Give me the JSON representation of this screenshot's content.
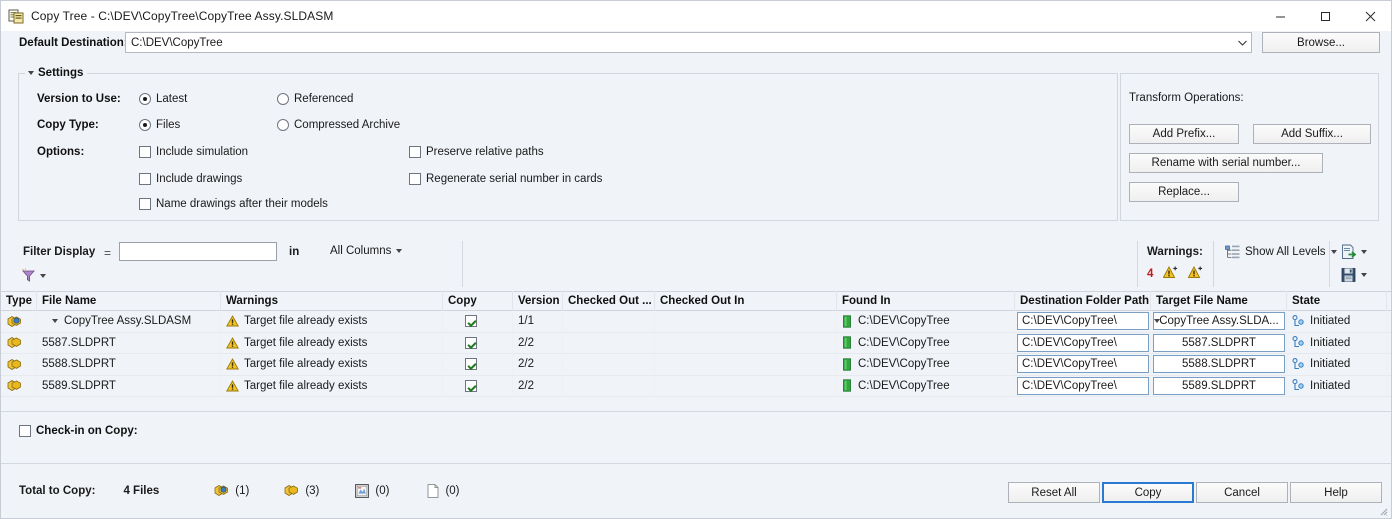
{
  "window": {
    "title": "Copy Tree - C:\\DEV\\CopyTree\\CopyTree Assy.SLDASM",
    "app_icon": "copy-tree-icon",
    "minimize_label": "─",
    "maximize_label": "□",
    "close_label": "✕"
  },
  "destination": {
    "label": "Default Destination:",
    "value": "C:\\DEV\\CopyTree",
    "placeholder": "",
    "browse_label": "Browse..."
  },
  "settings": {
    "group_label": "Settings",
    "version_label": "Version to Use:",
    "version_options": [
      {
        "label": "Latest",
        "selected": true
      },
      {
        "label": "Referenced",
        "selected": false
      }
    ],
    "copy_type_label": "Copy Type:",
    "copy_type_options": [
      {
        "label": "Files",
        "selected": true
      },
      {
        "label": "Compressed Archive",
        "selected": false
      }
    ],
    "options_label": "Options:",
    "options_left": [
      {
        "label": "Include simulation",
        "checked": false
      },
      {
        "label": "Include drawings",
        "checked": false
      },
      {
        "label": "Name drawings after their models",
        "checked": false
      }
    ],
    "options_right": [
      {
        "label": "Preserve relative paths",
        "checked": false
      },
      {
        "label": "Regenerate serial number in cards",
        "checked": false
      }
    ]
  },
  "transform": {
    "label": "Transform Operations:",
    "add_prefix": "Add Prefix...",
    "add_suffix": "Add Suffix...",
    "rename_serial": "Rename with serial number...",
    "replace": "Replace..."
  },
  "filterbar": {
    "filter_label": "Filter Display",
    "equals": "=",
    "filter_value": "",
    "filter_placeholder": "",
    "in_label": "in",
    "columns_value": "All Columns",
    "funnel_icon": "filter-icon",
    "warnings_label": "Warnings:",
    "warnings_count": "4",
    "levels_label": "Show All Levels",
    "export_icon": "export-icon",
    "save_icon": "save-icon"
  },
  "table": {
    "headers": [
      "Type",
      "File Name",
      "Warnings",
      "Copy",
      "Version",
      "Checked Out ...",
      "Checked Out In",
      "Found In",
      "Destination Folder Path",
      "Target File Name",
      "State"
    ],
    "rows": [
      {
        "type_icon": "assembly-icon",
        "file_name": "CopyTree Assy.SLDASM",
        "expandable": true,
        "warning": "Target file already exists",
        "copy": true,
        "version": "1/1",
        "checked_out_by": "",
        "checked_out_in": "",
        "found_in": "C:\\DEV\\CopyTree",
        "destination": "C:\\DEV\\CopyTree\\",
        "target_name": "CopyTree Assy.SLDA...",
        "target_has_dropdown": true,
        "state": "Initiated"
      },
      {
        "type_icon": "part-icon",
        "file_name": "5587.SLDPRT",
        "expandable": false,
        "warning": "Target file already exists",
        "copy": true,
        "version": "2/2",
        "checked_out_by": "",
        "checked_out_in": "",
        "found_in": "C:\\DEV\\CopyTree",
        "destination": "C:\\DEV\\CopyTree\\",
        "target_name": "5587.SLDPRT",
        "target_has_dropdown": false,
        "state": "Initiated"
      },
      {
        "type_icon": "part-icon",
        "file_name": "5588.SLDPRT",
        "expandable": false,
        "warning": "Target file already exists",
        "copy": true,
        "version": "2/2",
        "checked_out_by": "",
        "checked_out_in": "",
        "found_in": "C:\\DEV\\CopyTree",
        "destination": "C:\\DEV\\CopyTree\\",
        "target_name": "5588.SLDPRT",
        "target_has_dropdown": false,
        "state": "Initiated"
      },
      {
        "type_icon": "part-icon",
        "file_name": "5589.SLDPRT",
        "expandable": false,
        "warning": "Target file already exists",
        "copy": true,
        "version": "2/2",
        "checked_out_by": "",
        "checked_out_in": "",
        "found_in": "C:\\DEV\\CopyTree",
        "destination": "C:\\DEV\\CopyTree\\",
        "target_name": "5589.SLDPRT",
        "target_has_dropdown": false,
        "state": "Initiated"
      }
    ]
  },
  "footer": {
    "checkin_label": "Check-in on Copy:",
    "checkin_checked": false,
    "total_label": "Total to Copy:",
    "total_files": "4 Files",
    "counts": [
      {
        "icon": "assembly-icon",
        "value": "(1)"
      },
      {
        "icon": "part-icon",
        "value": "(3)"
      },
      {
        "icon": "drawing-icon",
        "value": "(0)"
      },
      {
        "icon": "document-icon",
        "value": "(0)"
      }
    ],
    "reset_label": "Reset All",
    "copy_label": "Copy",
    "cancel_label": "Cancel",
    "help_label": "Help"
  },
  "colors": {
    "accent": "#2a7ad1",
    "warning": "#e8a71c",
    "error": "#c21a1a",
    "ok": "#1e7b1e",
    "background": "#f0f3f8"
  }
}
